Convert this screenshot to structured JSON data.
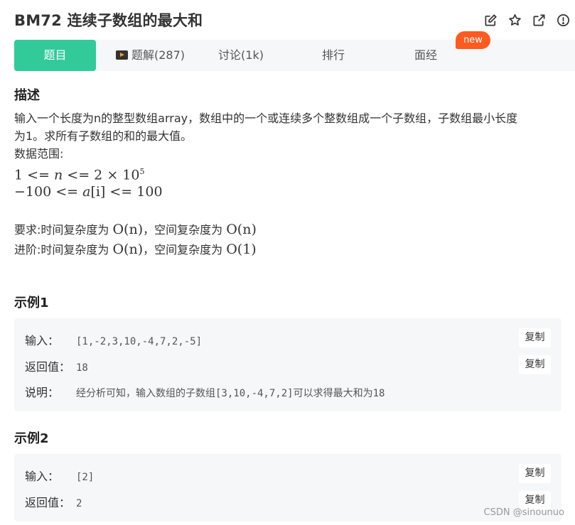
{
  "header": {
    "title": "BM72  连续子数组的最大和",
    "icons": [
      "edit-icon",
      "star-icon",
      "external-link-icon",
      "info-icon"
    ]
  },
  "tabs": [
    {
      "label": "题目",
      "active": true
    },
    {
      "label": "题解(287)",
      "icon": "video-play-icon"
    },
    {
      "label": "讨论(1k)"
    },
    {
      "label": "排行"
    },
    {
      "label": "面经",
      "badge": "new"
    }
  ],
  "description": {
    "heading": "描述",
    "line1": "输入一个长度为n的整型数组array，数组中的一个或连续多个整数组成一个子数组，子数组最小长度",
    "line2": "为1。求所有子数组的和的最大值。",
    "range_label": "数据范围:",
    "range1_lhs": "1 <= ",
    "range1_var": "n",
    "range1_rhs": " <= 2 × 10",
    "range1_exp": "5",
    "range2_lhs": "−100 <= ",
    "range2_var": "a",
    "range2_idx": "[i]",
    "range2_rhs": " <= 100",
    "req_prefix": "要求:时间复杂度为 ",
    "req_time": "O(n)",
    "req_mid": "，空间复杂度为 ",
    "req_space": "O(n)",
    "adv_prefix": "进阶:时间复杂度为 ",
    "adv_time": "O(n)",
    "adv_mid": "，空间复杂度为 ",
    "adv_space": "O(1)"
  },
  "examples": [
    {
      "heading": "示例1",
      "input_label": "输入：",
      "input_value": "[1,-2,3,10,-4,7,2,-5]",
      "output_label": "返回值：",
      "output_value": "18",
      "explain_label": "说明：",
      "explain_value": "经分析可知，输入数组的子数组[3,10,-4,7,2]可以求得最大和为18",
      "copy_label": "复制"
    },
    {
      "heading": "示例2",
      "input_label": "输入：",
      "input_value": "[2]",
      "output_label": "返回值：",
      "output_value": "2",
      "copy_label": "复制"
    }
  ],
  "watermark": "CSDN @sinounuo",
  "colors": {
    "accent": "#32ca99",
    "badge": "#ff5a1f",
    "panel": "#f6f7f8"
  }
}
